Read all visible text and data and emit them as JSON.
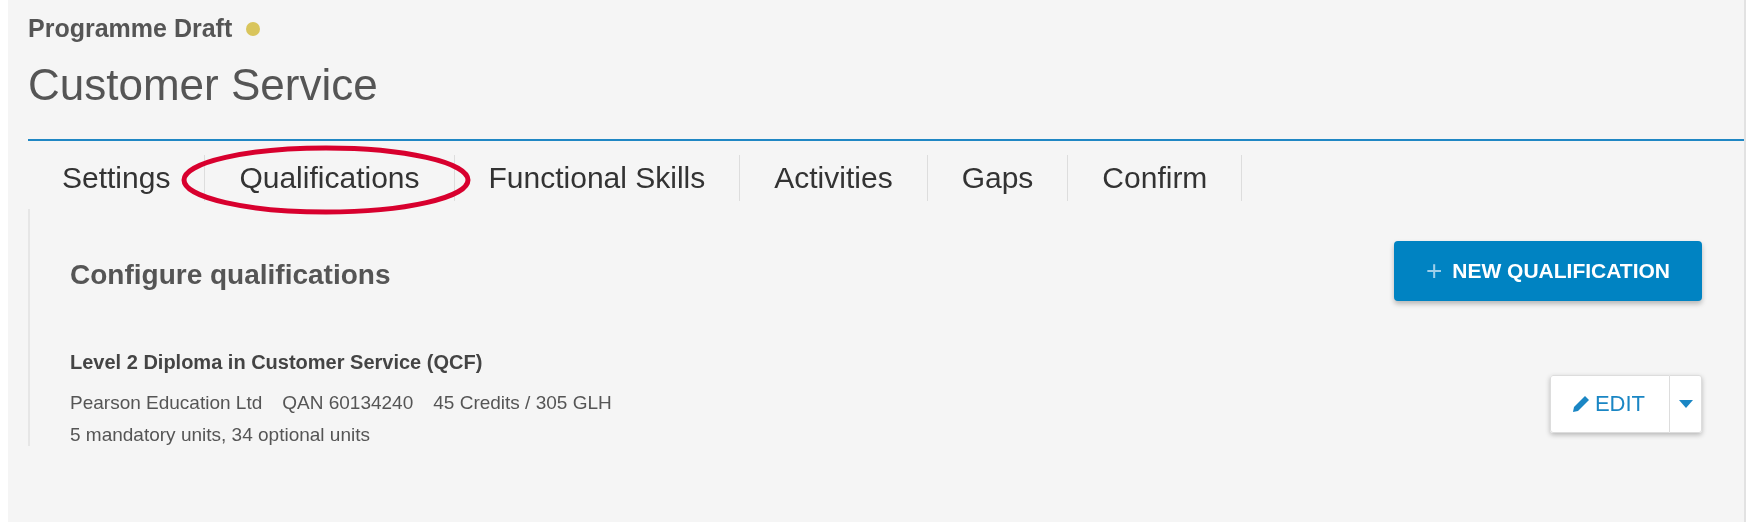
{
  "header": {
    "status": "Programme Draft",
    "title": "Customer Service"
  },
  "tabs": [
    {
      "label": "Settings"
    },
    {
      "label": "Qualifications"
    },
    {
      "label": "Functional Skills"
    },
    {
      "label": "Activities"
    },
    {
      "label": "Gaps"
    },
    {
      "label": "Confirm"
    }
  ],
  "panel": {
    "heading": "Configure qualifications",
    "new_button": {
      "icon": "+",
      "label": "NEW QUALIFICATION"
    },
    "qualifications": [
      {
        "title": "Level 2 Diploma in Customer Service (QCF)",
        "awarding_body": "Pearson Education Ltd",
        "qan": "QAN 60134240",
        "credits": "45 Credits / 305 GLH",
        "units": "5 mandatory units, 34 optional units",
        "edit_label": "EDIT"
      }
    ]
  }
}
